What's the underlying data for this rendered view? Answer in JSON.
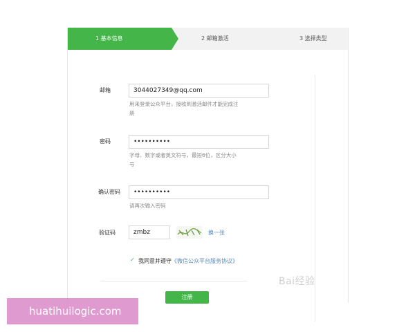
{
  "steps": {
    "step1": "1 基本信息",
    "step2": "2 邮箱激活",
    "step3": "3 选择类型"
  },
  "form": {
    "email": {
      "label": "邮箱",
      "value": "3044027349@qq.com",
      "hint_line1": "用来登录公众平台，接收到激活邮件才能完成注",
      "hint_line2": "册"
    },
    "password": {
      "label": "密码",
      "value": "••••••••••",
      "hint_line1": "字母、数字或者英文符号，最短6位，区分大小",
      "hint_line2": "号"
    },
    "confirm_password": {
      "label": "确认密码",
      "value": "••••••••••",
      "hint": "请再次输入密码"
    },
    "captcha": {
      "label": "验证码",
      "value": "zmbz",
      "refresh_label": "换一张"
    },
    "agreement": {
      "check": "✓",
      "text": "我同意并遵守",
      "link_text": "《微信公众平台服务协议》"
    },
    "register_label": "注册"
  },
  "watermark_text": "Bai经验",
  "badge_text": "huatihuilogic.com",
  "colors": {
    "accent": "#44b549",
    "link": "#5a8bb9",
    "badge": "#d98ac8"
  }
}
